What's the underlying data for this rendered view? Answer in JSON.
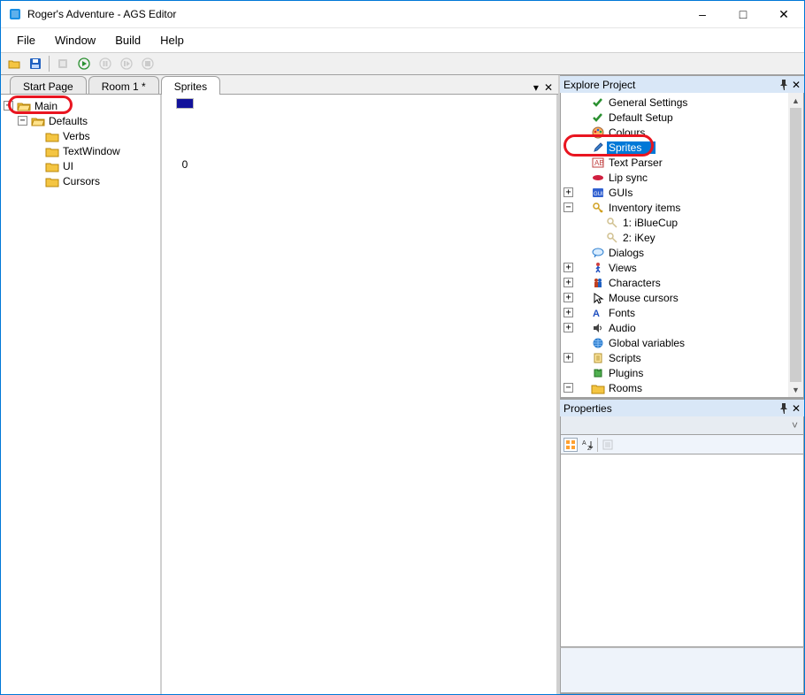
{
  "window": {
    "title": "Roger's Adventure - AGS Editor"
  },
  "menu": {
    "file": "File",
    "window": "Window",
    "build": "Build",
    "help": "Help"
  },
  "doc_tabs": {
    "start": "Start Page",
    "room1": "Room 1 *",
    "sprites": "Sprites"
  },
  "folder_tree": {
    "main": "Main",
    "defaults": "Defaults",
    "verbs": "Verbs",
    "textwindow": "TextWindow",
    "ui": "UI",
    "cursors": "Cursors"
  },
  "sprite_area": {
    "sprite0_number": "0"
  },
  "explore": {
    "title": "Explore Project",
    "items": {
      "general_settings": "General Settings",
      "default_setup": "Default Setup",
      "colours": "Colours",
      "sprites": "Sprites",
      "text_parser": "Text Parser",
      "lip_sync": "Lip sync",
      "guis": "GUIs",
      "inventory_items": "Inventory items",
      "inv_blue_cup": "1: iBlueCup",
      "inv_key": "2: iKey",
      "dialogs": "Dialogs",
      "views": "Views",
      "characters": "Characters",
      "mouse_cursors": "Mouse cursors",
      "fonts": "Fonts",
      "audio": "Audio",
      "global_variables": "Global variables",
      "scripts": "Scripts",
      "plugins": "Plugins",
      "rooms": "Rooms"
    }
  },
  "properties": {
    "title": "Properties"
  }
}
